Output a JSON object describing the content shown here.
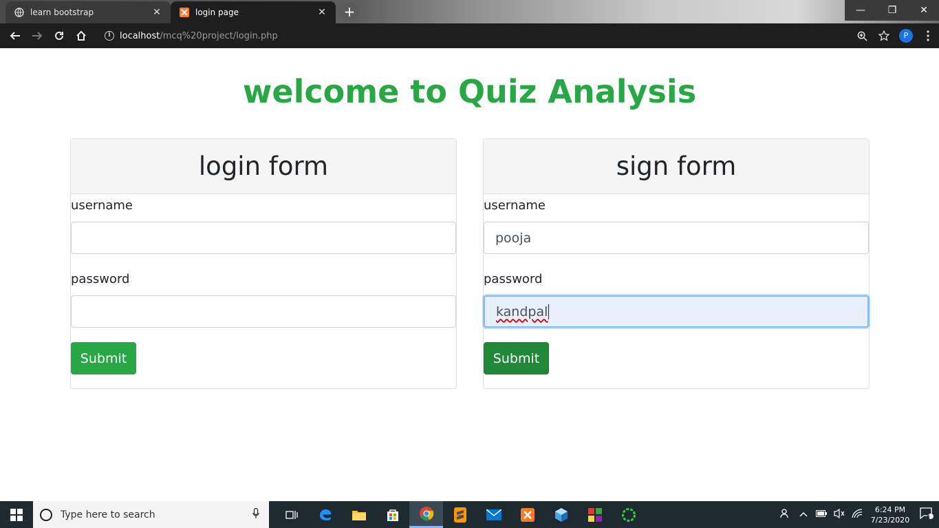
{
  "browser": {
    "tabs": [
      {
        "title": "learn bootstrap",
        "close": "✕"
      },
      {
        "title": "login page",
        "close": "✕"
      }
    ],
    "new_tab": "+",
    "url_host": "localhost",
    "url_path": "/mcq%20project/login.php",
    "profile_initial": "P",
    "window_controls": {
      "minimize": "—",
      "restore": "❐",
      "close": "✕"
    }
  },
  "page": {
    "title": "welcome to Quiz Analysis",
    "login_form": {
      "header": "login form",
      "username_label": "username",
      "username_value": "",
      "password_label": "password",
      "password_value": "",
      "submit_label": "Submit"
    },
    "sign_form": {
      "header": "sign form",
      "username_label": "username",
      "username_value": "pooja",
      "password_label": "password",
      "password_value": "kandpal",
      "submit_label": "Submit"
    }
  },
  "taskbar": {
    "search_placeholder": "Type here to search",
    "time": "6:24 PM",
    "date": "7/23/2020",
    "notification_count": "1"
  },
  "colors": {
    "accent_green": "#28a745",
    "active_green": "#218838",
    "browser_dark": "#1e1e1e",
    "taskbar": "#1f2a30"
  }
}
